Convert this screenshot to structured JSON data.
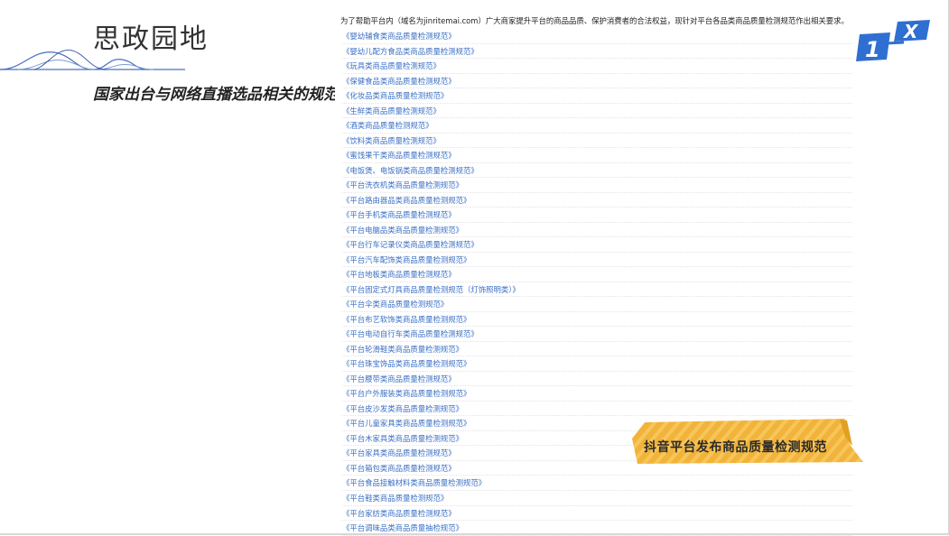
{
  "header": {
    "title": "思政园地",
    "subtitle": "国家出台与网络直播选品相关的规范"
  },
  "intro": "为了帮助平台内（域名为jinritemai.com）广大商家提升平台的商品品质、保护消费者的合法权益，现针对平台各品类商品质量检测规范作出相关要求。",
  "links": [
    "《婴幼辅食类商品质量检测规范》",
    "《婴幼儿配方食品类商品质量检测规范》",
    "《玩具类商品质量检测规范》",
    "《保健食品类商品质量检测规范》",
    "《化妆品类商品质量检测规范》",
    "《生鲜类商品质量检测规范》",
    "《酒类商品质量检测规范》",
    "《饮料类商品质量检测规范》",
    "《蜜饯果干类商品质量检测规范》",
    "《电饭煲、电饭锅类商品质量检测规范》",
    "《平台洗衣机类商品质量检测规范》",
    "《平台路由器品类商品质量检测规范》",
    "《平台手机类商品质量检测规范》",
    "《平台电脑品类商品质量检测规范》",
    "《平台行车记录仪类商品质量检测规范》",
    "《平台汽车配饰类商品质量检测规范》",
    "《平台地板类商品质量检测规范》",
    "《平台固定式灯具商品质量检测规范（灯饰照明类）》",
    "《平台伞类商品质量检测规范》",
    "《平台布艺软饰类商品质量检测规范》",
    "《平台电动自行车类商品质量检测规范》",
    "《平台轮滑鞋类商品质量检测规范》",
    "《平台珠宝饰品类商品质量检测规范》",
    "《平台腰带类商品质量检测规范》",
    "《平台户外服装类商品质量检测规范》",
    "《平台皮沙发类商品质量检测规范》",
    "《平台儿童家具类商品质量检测规范》",
    "《平台木家具类商品质量检测规范》",
    "《平台家具类商品质量检测规范》",
    "《平台箱包类商品质量检测规范》",
    "《平台食品接触材料类商品质量检测规范》",
    "《平台鞋类商品质量检测规范》",
    "《平台家纺类商品质量检测规范》",
    "《平台调味品类商品质量抽检规范》"
  ],
  "logo": {
    "digit": "1",
    "letter": "X",
    "color": "#2f6fd1"
  },
  "banner": {
    "text": "抖音平台发布商品质量检测规范",
    "color": "#f2b33a"
  },
  "colors": {
    "link": "#3a6fc4",
    "wave": "#4a6fbf"
  }
}
